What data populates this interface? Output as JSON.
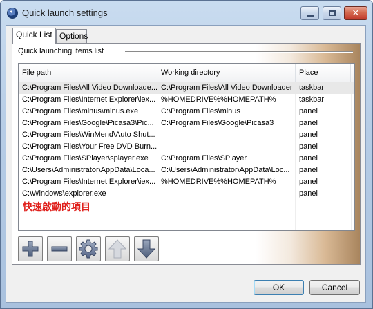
{
  "window": {
    "title": "Quick launch settings"
  },
  "tabs": [
    {
      "label": "Quick List",
      "active": true
    },
    {
      "label": "Options",
      "active": false
    }
  ],
  "group": {
    "label": "Quick launching items list"
  },
  "table": {
    "columns": [
      "File path",
      "Working directory",
      "Place"
    ],
    "rows": [
      {
        "file_path": "C:\\Program Files\\All Video Downloade...",
        "working_dir": "C:\\Program Files\\All Video Downloader",
        "place": "taskbar",
        "selected": true
      },
      {
        "file_path": "C:\\Program Files\\Internet Explorer\\iex...",
        "working_dir": "%HOMEDRIVE%%HOMEPATH%",
        "place": "taskbar"
      },
      {
        "file_path": "C:\\Program Files\\minus\\minus.exe",
        "working_dir": "C:\\Program Files\\minus",
        "place": "panel"
      },
      {
        "file_path": "C:\\Program Files\\Google\\Picasa3\\Pic...",
        "working_dir": "C:\\Program Files\\Google\\Picasa3",
        "place": "panel"
      },
      {
        "file_path": "C:\\Program Files\\WinMend\\Auto Shut...",
        "working_dir": "",
        "place": "panel"
      },
      {
        "file_path": "C:\\Program Files\\Your Free DVD Burn...",
        "working_dir": "",
        "place": "panel"
      },
      {
        "file_path": "C:\\Program Files\\SPlayer\\splayer.exe",
        "working_dir": "C:\\Program Files\\SPlayer",
        "place": "panel"
      },
      {
        "file_path": "C:\\Users\\Administrator\\AppData\\Loca...",
        "working_dir": "C:\\Users\\Administrator\\AppData\\Loc...",
        "place": "panel"
      },
      {
        "file_path": "C:\\Program Files\\Internet Explorer\\iex...",
        "working_dir": "%HOMEDRIVE%%HOMEPATH%",
        "place": "panel"
      },
      {
        "file_path": "C:\\Windows\\explorer.exe",
        "working_dir": "",
        "place": "panel"
      }
    ]
  },
  "annotation": "快速啟動的項目",
  "toolbar": {
    "buttons": [
      "add-icon",
      "remove-icon",
      "settings-gear-icon",
      "move-up-arrow-icon",
      "move-down-arrow-icon"
    ]
  },
  "buttons": {
    "ok": "OK",
    "cancel": "Cancel"
  },
  "colors": {
    "annotation": "#e0201c",
    "close_button": "#c0392b",
    "panel_gradient_end": "#a9855e"
  }
}
